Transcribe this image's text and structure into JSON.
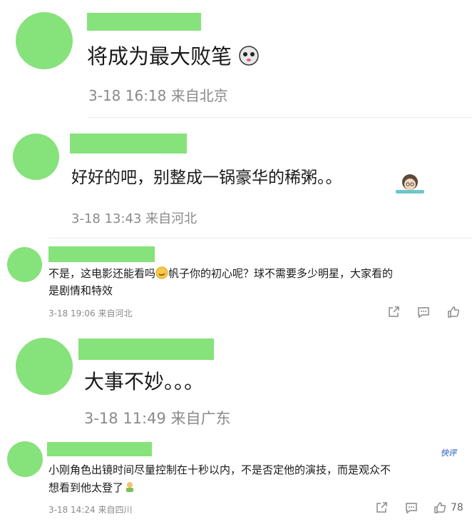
{
  "comments": [
    {
      "text": "将成为最大败笔",
      "location_time": "3-18 16:18  来自北京"
    },
    {
      "text": "好好的吧，别整成一锅豪华的稀粥。。",
      "location_time": "3-18 13:43  来自河北"
    },
    {
      "text_line1": "不是，这电影还能看吗",
      "text_line1_b": "帆子你的初心呢？球不需要多少明星，大家看的",
      "text_line2": "是剧情和特效",
      "location_time": "3-18 19:06  来自河北"
    },
    {
      "text": "大事不妙。。。",
      "location_time": "3-18 11:49  来自广东"
    },
    {
      "text_line1": "小刚角色出镜时间尽量控制在十秒以内，不是否定他的演技，而是观众不",
      "text_line2": "想看到他太登了",
      "location_time": "3-18 14:24  来自四川",
      "like_count": "78",
      "badge": "快评"
    }
  ],
  "colors": {
    "avatar_green": "#86e27a",
    "meta_gray": "#8a8a8a"
  },
  "icons": [
    "share-icon",
    "comment-icon",
    "like-icon",
    "emoji-icon"
  ]
}
